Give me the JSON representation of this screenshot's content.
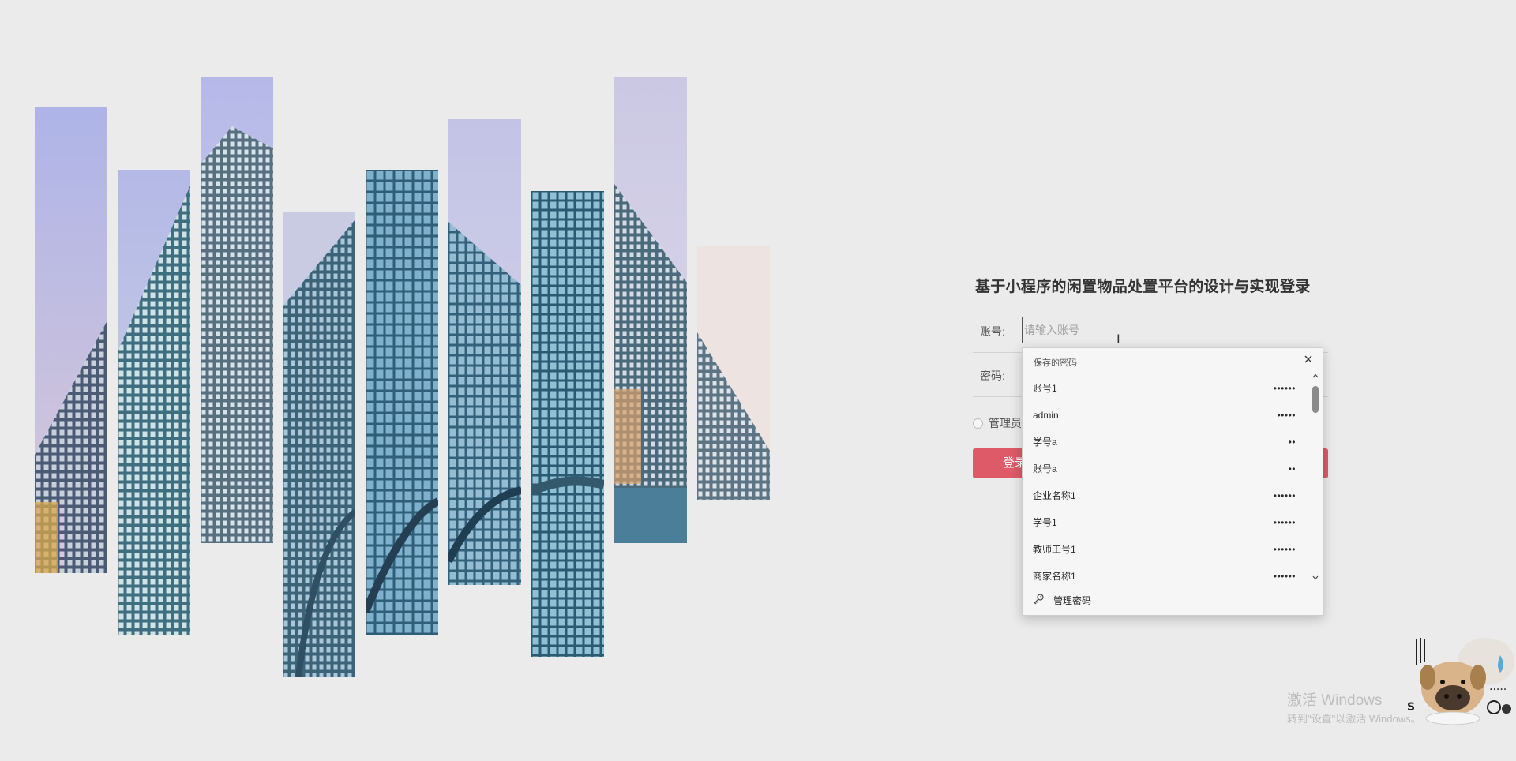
{
  "login": {
    "title": "基于小程序的闲置物品处置平台的设计与实现登录",
    "account_label": "账号:",
    "account_placeholder": "请输入账号",
    "password_label": "密码:",
    "role_option": "管理员",
    "login_button": "登录"
  },
  "saved_passwords": {
    "header": "保存的密码",
    "items": [
      {
        "username": "账号1",
        "password_mask": "••••••"
      },
      {
        "username": "admin",
        "password_mask": "•••••"
      },
      {
        "username": "学号a",
        "password_mask": "••"
      },
      {
        "username": "账号a",
        "password_mask": "••"
      },
      {
        "username": "企业名称1",
        "password_mask": "••••••"
      },
      {
        "username": "学号1",
        "password_mask": "••••••"
      },
      {
        "username": "教师工号1",
        "password_mask": "••••••"
      },
      {
        "username": "商家名称1",
        "password_mask": "••••••"
      }
    ],
    "manage_label": "管理密码"
  },
  "watermark": {
    "title": "激活 Windows",
    "subtitle": "转到\"设置\"以激活 Windows。"
  },
  "sticker": {
    "text": "S"
  },
  "colors": {
    "background": "#ebebeb",
    "login_button": "#de5a68",
    "sky": "#c7c6e6",
    "glass": "#4f86a8"
  },
  "icons": {
    "close": "close-icon",
    "key": "key-icon",
    "scroll_up": "chevron-up-icon",
    "scroll_down": "chevron-down-icon"
  }
}
